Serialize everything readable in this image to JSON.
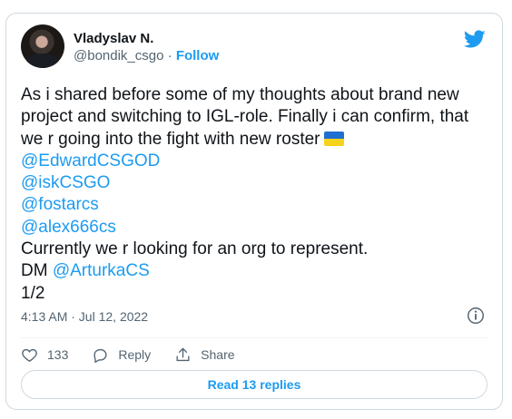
{
  "tweet": {
    "author": {
      "name": "Vladyslav N.",
      "handle": "@bondik_csgo",
      "separator": " · ",
      "follow_label": "Follow"
    },
    "body": {
      "text_line_1": "As i shared before some of my thoughts about brand new project and switching to IGL-role. Finally i can confirm, that we r going into the fight with new roster",
      "mentions": [
        "@EdwardCSGOD",
        "@iskCSGO",
        "@fostarcs",
        "@alex666cs"
      ],
      "text_line_2": "Currently we r looking for an org to represent.",
      "dm_prefix": "DM ",
      "dm_mention": "@ArturkaCS",
      "thread_count": "1/2"
    },
    "timestamp": "4:13 AM · Jul 12, 2022",
    "actions": {
      "like_count": "133",
      "reply_label": "Reply",
      "share_label": "Share"
    },
    "read_replies_label": "Read 13 replies"
  },
  "colors": {
    "accent": "#1d9bf0",
    "text": "#0f1419",
    "muted": "#536471",
    "border": "#cfd9de"
  },
  "icons": [
    "twitter-bird-icon",
    "ukraine-flag-icon",
    "info-icon",
    "heart-icon",
    "reply-icon",
    "share-icon"
  ]
}
